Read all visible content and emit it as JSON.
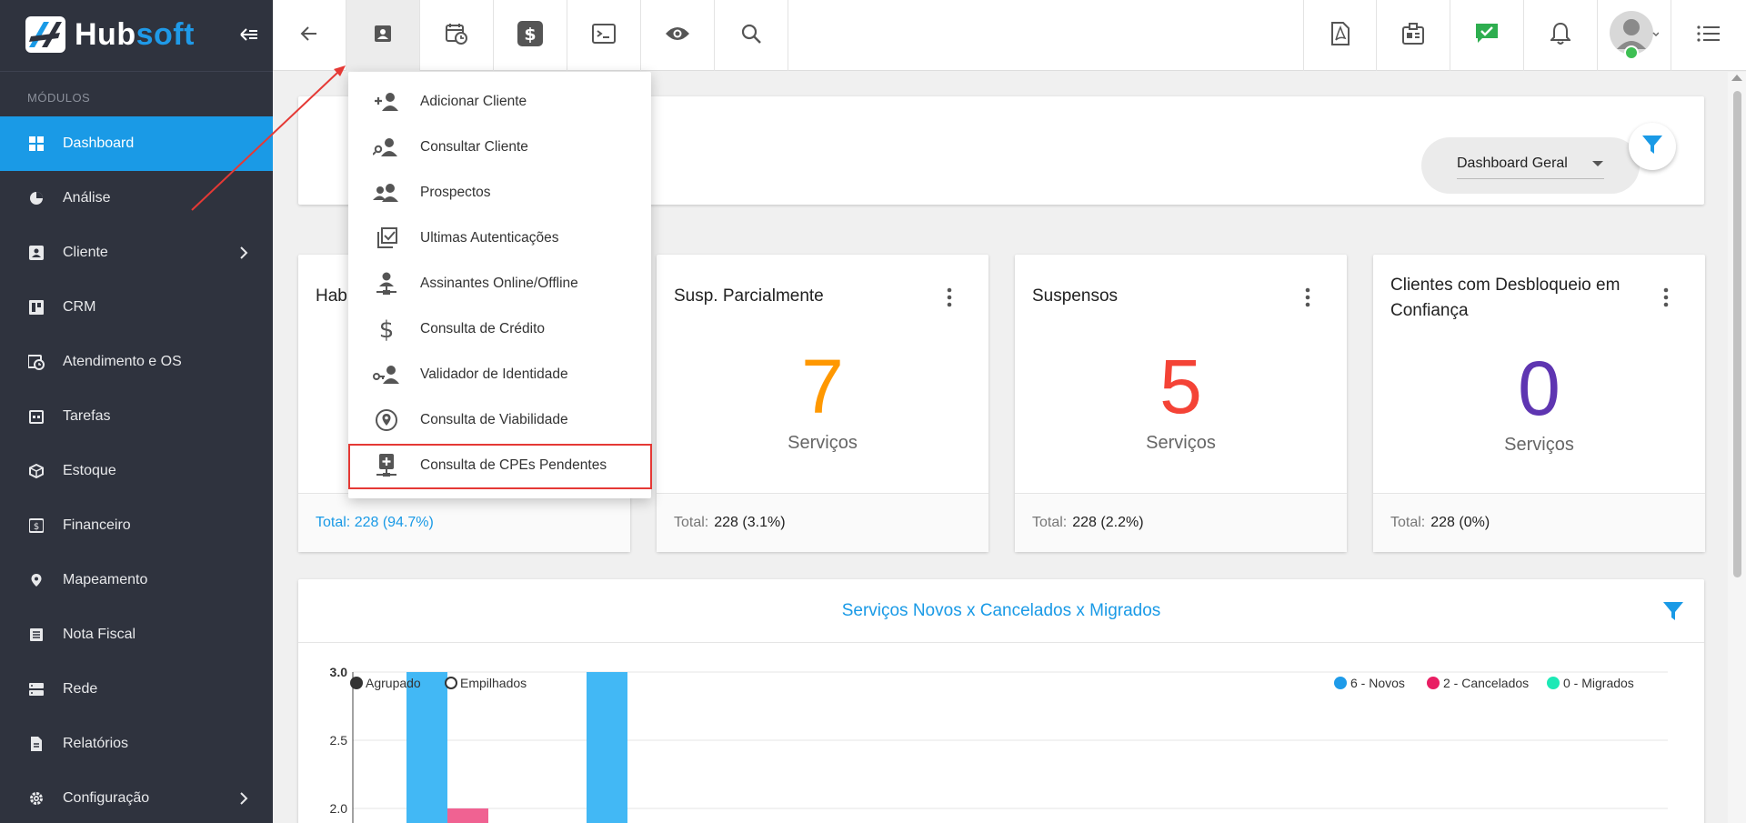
{
  "brand": {
    "name_part1": "Hub",
    "name_part2": "soft",
    "accent": "#1a9ae6",
    "sidebar_bg": "#2f333e"
  },
  "sidebar": {
    "section_label": "MÓDULOS",
    "items": [
      {
        "label": "Dashboard",
        "icon": "dashboard-icon",
        "active": true
      },
      {
        "label": "Análise",
        "icon": "pie-chart-icon"
      },
      {
        "label": "Cliente",
        "icon": "contact-card-icon",
        "has_submenu": true
      },
      {
        "label": "CRM",
        "icon": "crm-board-icon"
      },
      {
        "label": "Atendimento e OS",
        "icon": "calendar-clock-icon"
      },
      {
        "label": "Tarefas",
        "icon": "task-calendar-icon"
      },
      {
        "label": "Estoque",
        "icon": "cube-icon"
      },
      {
        "label": "Financeiro",
        "icon": "money-icon"
      },
      {
        "label": "Mapeamento",
        "icon": "map-pin-icon"
      },
      {
        "label": "Nota Fiscal",
        "icon": "receipt-icon"
      },
      {
        "label": "Rede",
        "icon": "server-icon"
      },
      {
        "label": "Relatórios",
        "icon": "report-file-icon"
      },
      {
        "label": "Configuração",
        "icon": "gear-icon",
        "has_submenu": true
      }
    ]
  },
  "topbar": {
    "icons": [
      "back-arrow-icon",
      "client-card-icon",
      "schedule-icon",
      "dollar-icon",
      "terminal-icon",
      "eye-icon",
      "search-icon",
      "pdf-icon",
      "badge-icon",
      "check-message-icon",
      "bell-icon",
      "avatar",
      "menu-list-icon"
    ]
  },
  "client_menu": {
    "items": [
      {
        "label": "Adicionar Cliente",
        "icon": "person-add-icon"
      },
      {
        "label": "Consultar Cliente",
        "icon": "person-search-icon"
      },
      {
        "label": "Prospectos",
        "icon": "people-icon"
      },
      {
        "label": "Ultimas Autenticações",
        "icon": "checklist-icon"
      },
      {
        "label": "Assinantes Online/Offline",
        "icon": "person-network-icon"
      },
      {
        "label": "Consulta de Crédito",
        "icon": "dollar-sign-icon"
      },
      {
        "label": "Validador de Identidade",
        "icon": "key-person-icon"
      },
      {
        "label": "Consulta de Viabilidade",
        "icon": "location-icon"
      },
      {
        "label": "Consulta de CPEs Pendentes",
        "icon": "device-add-icon",
        "highlighted": true
      }
    ]
  },
  "filter": {
    "dashboard_select": "Dashboard Geral"
  },
  "stats": [
    {
      "title": "Hab",
      "value": "",
      "unit": "",
      "footer": "Total: 228 (94.7%)",
      "footer_color": "#1a9ae6"
    },
    {
      "title": "Susp. Parcialmente",
      "value": "7",
      "unit": "Serviços",
      "footer_label": "Total:",
      "footer_value": "228 (3.1%)",
      "color": "#ff9800"
    },
    {
      "title": "Suspensos",
      "value": "5",
      "unit": "Serviços",
      "footer_label": "Total:",
      "footer_value": "228 (2.2%)",
      "color": "#f44336"
    },
    {
      "title": "Clientes com Desbloqueio em Confiança",
      "value": "0",
      "unit": "Serviços",
      "footer_label": "Total:",
      "footer_value": "228 (0%)",
      "color": "#5e35b1"
    }
  ],
  "chart_data": {
    "type": "bar",
    "title": "Serviços Novos x Cancelados x Migrados",
    "mode_options": [
      {
        "label": "Agrupado",
        "selected": true
      },
      {
        "label": "Empilhados",
        "selected": false
      }
    ],
    "y_ticks": [
      "3.0",
      "2.5",
      "2.0"
    ],
    "ylim": [
      2.0,
      3.0
    ],
    "legend_position": "top-right",
    "series": [
      {
        "name": "6 - Novos",
        "color": "#42b8f5",
        "values": [
          3.0,
          3.0
        ]
      },
      {
        "name": "2 - Cancelados",
        "color": "#f06292",
        "values": [
          2.0,
          0
        ]
      },
      {
        "name": "0 - Migrados",
        "color": "#26d7a0",
        "values": [
          0,
          0
        ]
      }
    ],
    "legend_colors": [
      "#1e9be9",
      "#e91e63",
      "#1de9b6"
    ]
  }
}
